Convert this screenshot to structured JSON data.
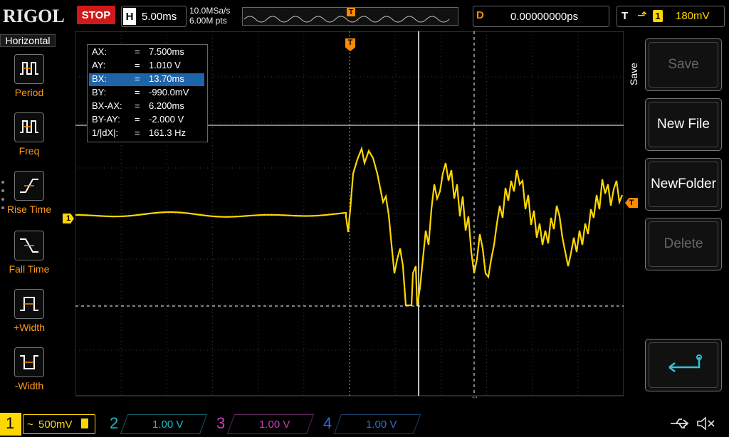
{
  "topbar": {
    "logo": "RIGOL",
    "run_state": "STOP",
    "horizontal_label": "H",
    "horizontal_scale": "5.00ms",
    "sample_rate": "10.0MSa/s",
    "memory_depth": "6.00M pts",
    "trigger_marker": "T",
    "delay_label": "D",
    "delay_value": "0.00000000ps",
    "trigger_label": "T",
    "trigger_source": "1",
    "trigger_level": "180mV"
  },
  "left_menu": {
    "title": "Horizontal",
    "items": [
      {
        "label": "Period",
        "icon": "period-icon"
      },
      {
        "label": "Freq",
        "icon": "frequency-icon"
      },
      {
        "label": "Rise Time",
        "icon": "rise-time-icon"
      },
      {
        "label": "Fall Time",
        "icon": "fall-time-icon"
      },
      {
        "label": "+Width",
        "icon": "positive-width-icon"
      },
      {
        "label": "-Width",
        "icon": "negative-width-icon"
      }
    ]
  },
  "cursor_readout": {
    "rows": [
      {
        "key": "AX:",
        "eq": "=",
        "value": "7.500ms"
      },
      {
        "key": "AY:",
        "eq": "=",
        "value": "1.010 V"
      },
      {
        "key": "BX:",
        "eq": "=",
        "value": "13.70ms"
      },
      {
        "key": "BY:",
        "eq": "=",
        "value": "-990.0mV"
      },
      {
        "key": "BX-AX:",
        "eq": "=",
        "value": "6.200ms"
      },
      {
        "key": "BY-AY:",
        "eq": "=",
        "value": "-2.000 V"
      },
      {
        "key": "1/|dX|:",
        "eq": "=",
        "value": "161.3 Hz"
      }
    ],
    "selected_row": "BX:"
  },
  "markers": {
    "channel1_marker": "1",
    "trigger_top_marker": "T",
    "trigger_level_marker": "T"
  },
  "right_menu": {
    "title": "Save",
    "buttons": [
      {
        "label": "Save",
        "enabled": false
      },
      {
        "label": "New File",
        "enabled": true
      },
      {
        "label": "NewFolder",
        "enabled": true
      },
      {
        "label": "Delete",
        "enabled": false
      },
      {
        "label": "",
        "icon": "return-arrow-icon",
        "enabled": true
      }
    ]
  },
  "bottombar": {
    "channels": [
      {
        "num": "1",
        "coupling": "~",
        "scale": "500mV",
        "color": "#ffd700",
        "active": true
      },
      {
        "num": "2",
        "scale": "1.00 V",
        "color": "#1fb8c8",
        "active": false
      },
      {
        "num": "3",
        "scale": "1.00 V",
        "color": "#c83fb8",
        "active": false
      },
      {
        "num": "4",
        "scale": "1.00 V",
        "color": "#2a6fd8",
        "active": false
      }
    ],
    "usb_icon": "usb-icon",
    "speaker_icon": "speaker-muted-icon"
  },
  "colors": {
    "trace": "#ffd700",
    "accent": "#ff8a00",
    "stop": "#d01a1a",
    "grid": "#3a3a3a"
  }
}
